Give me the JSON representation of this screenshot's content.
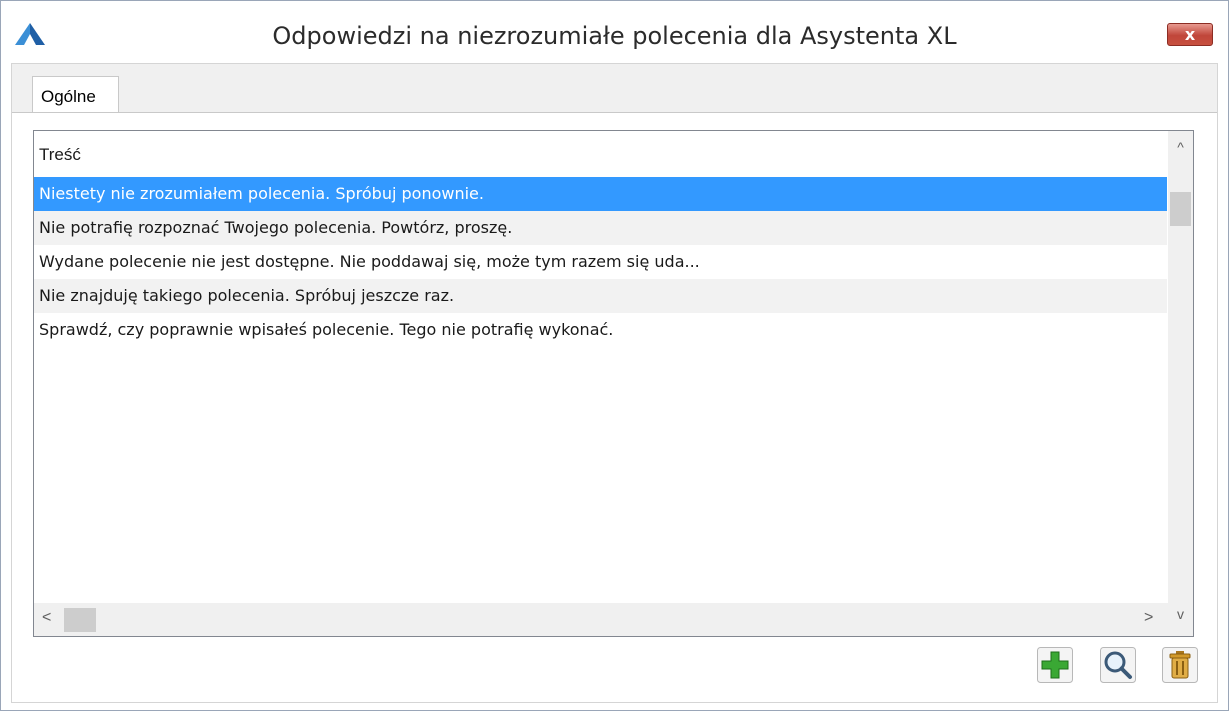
{
  "window": {
    "title": "Odpowiedzi na niezrozumiałe polecenia dla Asystenta XL",
    "close_label": "x"
  },
  "tabs": [
    {
      "label": "Ogólne",
      "active": true
    }
  ],
  "grid": {
    "column_header": "Treść",
    "rows": [
      {
        "text": "Niestety nie zrozumiałem polecenia. Spróbuj ponownie.",
        "selected": true
      },
      {
        "text": "Nie potrafię rozpoznać Twojego polecenia. Powtórz, proszę.",
        "selected": false
      },
      {
        "text": "Wydane polecenie nie jest dostępne. Nie poddawaj się, może tym razem się uda...",
        "selected": false
      },
      {
        "text": "Nie znajduję takiego polecenia. Spróbuj jeszcze raz.",
        "selected": false
      },
      {
        "text": "Sprawdź, czy poprawnie wpisałeś polecenie. Tego nie potrafię wykonać.",
        "selected": false
      }
    ],
    "scroll_glyphs": {
      "up": "^",
      "down": "v",
      "left": "<",
      "right": ">"
    }
  },
  "toolbar": {
    "add_icon": "plus-icon",
    "view_icon": "magnifier-icon",
    "delete_icon": "trash-icon"
  },
  "colors": {
    "selection": "#3399ff",
    "close_button": "#c7503f",
    "add_icon": "#3aa834",
    "delete_icon": "#d29a2a"
  }
}
